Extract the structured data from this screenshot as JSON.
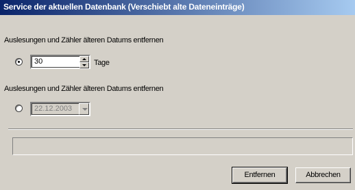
{
  "window": {
    "title": "Service der aktuellen Datenbank (Verschiebt alte Dateneinträge)"
  },
  "option_days": {
    "heading": "Auslesungen und Zähler älteren Datums entfernen",
    "value": "30",
    "unit": "Tage",
    "selected": true
  },
  "option_date": {
    "heading": "Auslesungen und Zähler älteren Datums entfernen",
    "value": "22.12.2003",
    "selected": false,
    "disabled": true
  },
  "progress": {
    "value": 0
  },
  "buttons": {
    "remove": "Entfernen",
    "cancel": "Abbrechen"
  }
}
